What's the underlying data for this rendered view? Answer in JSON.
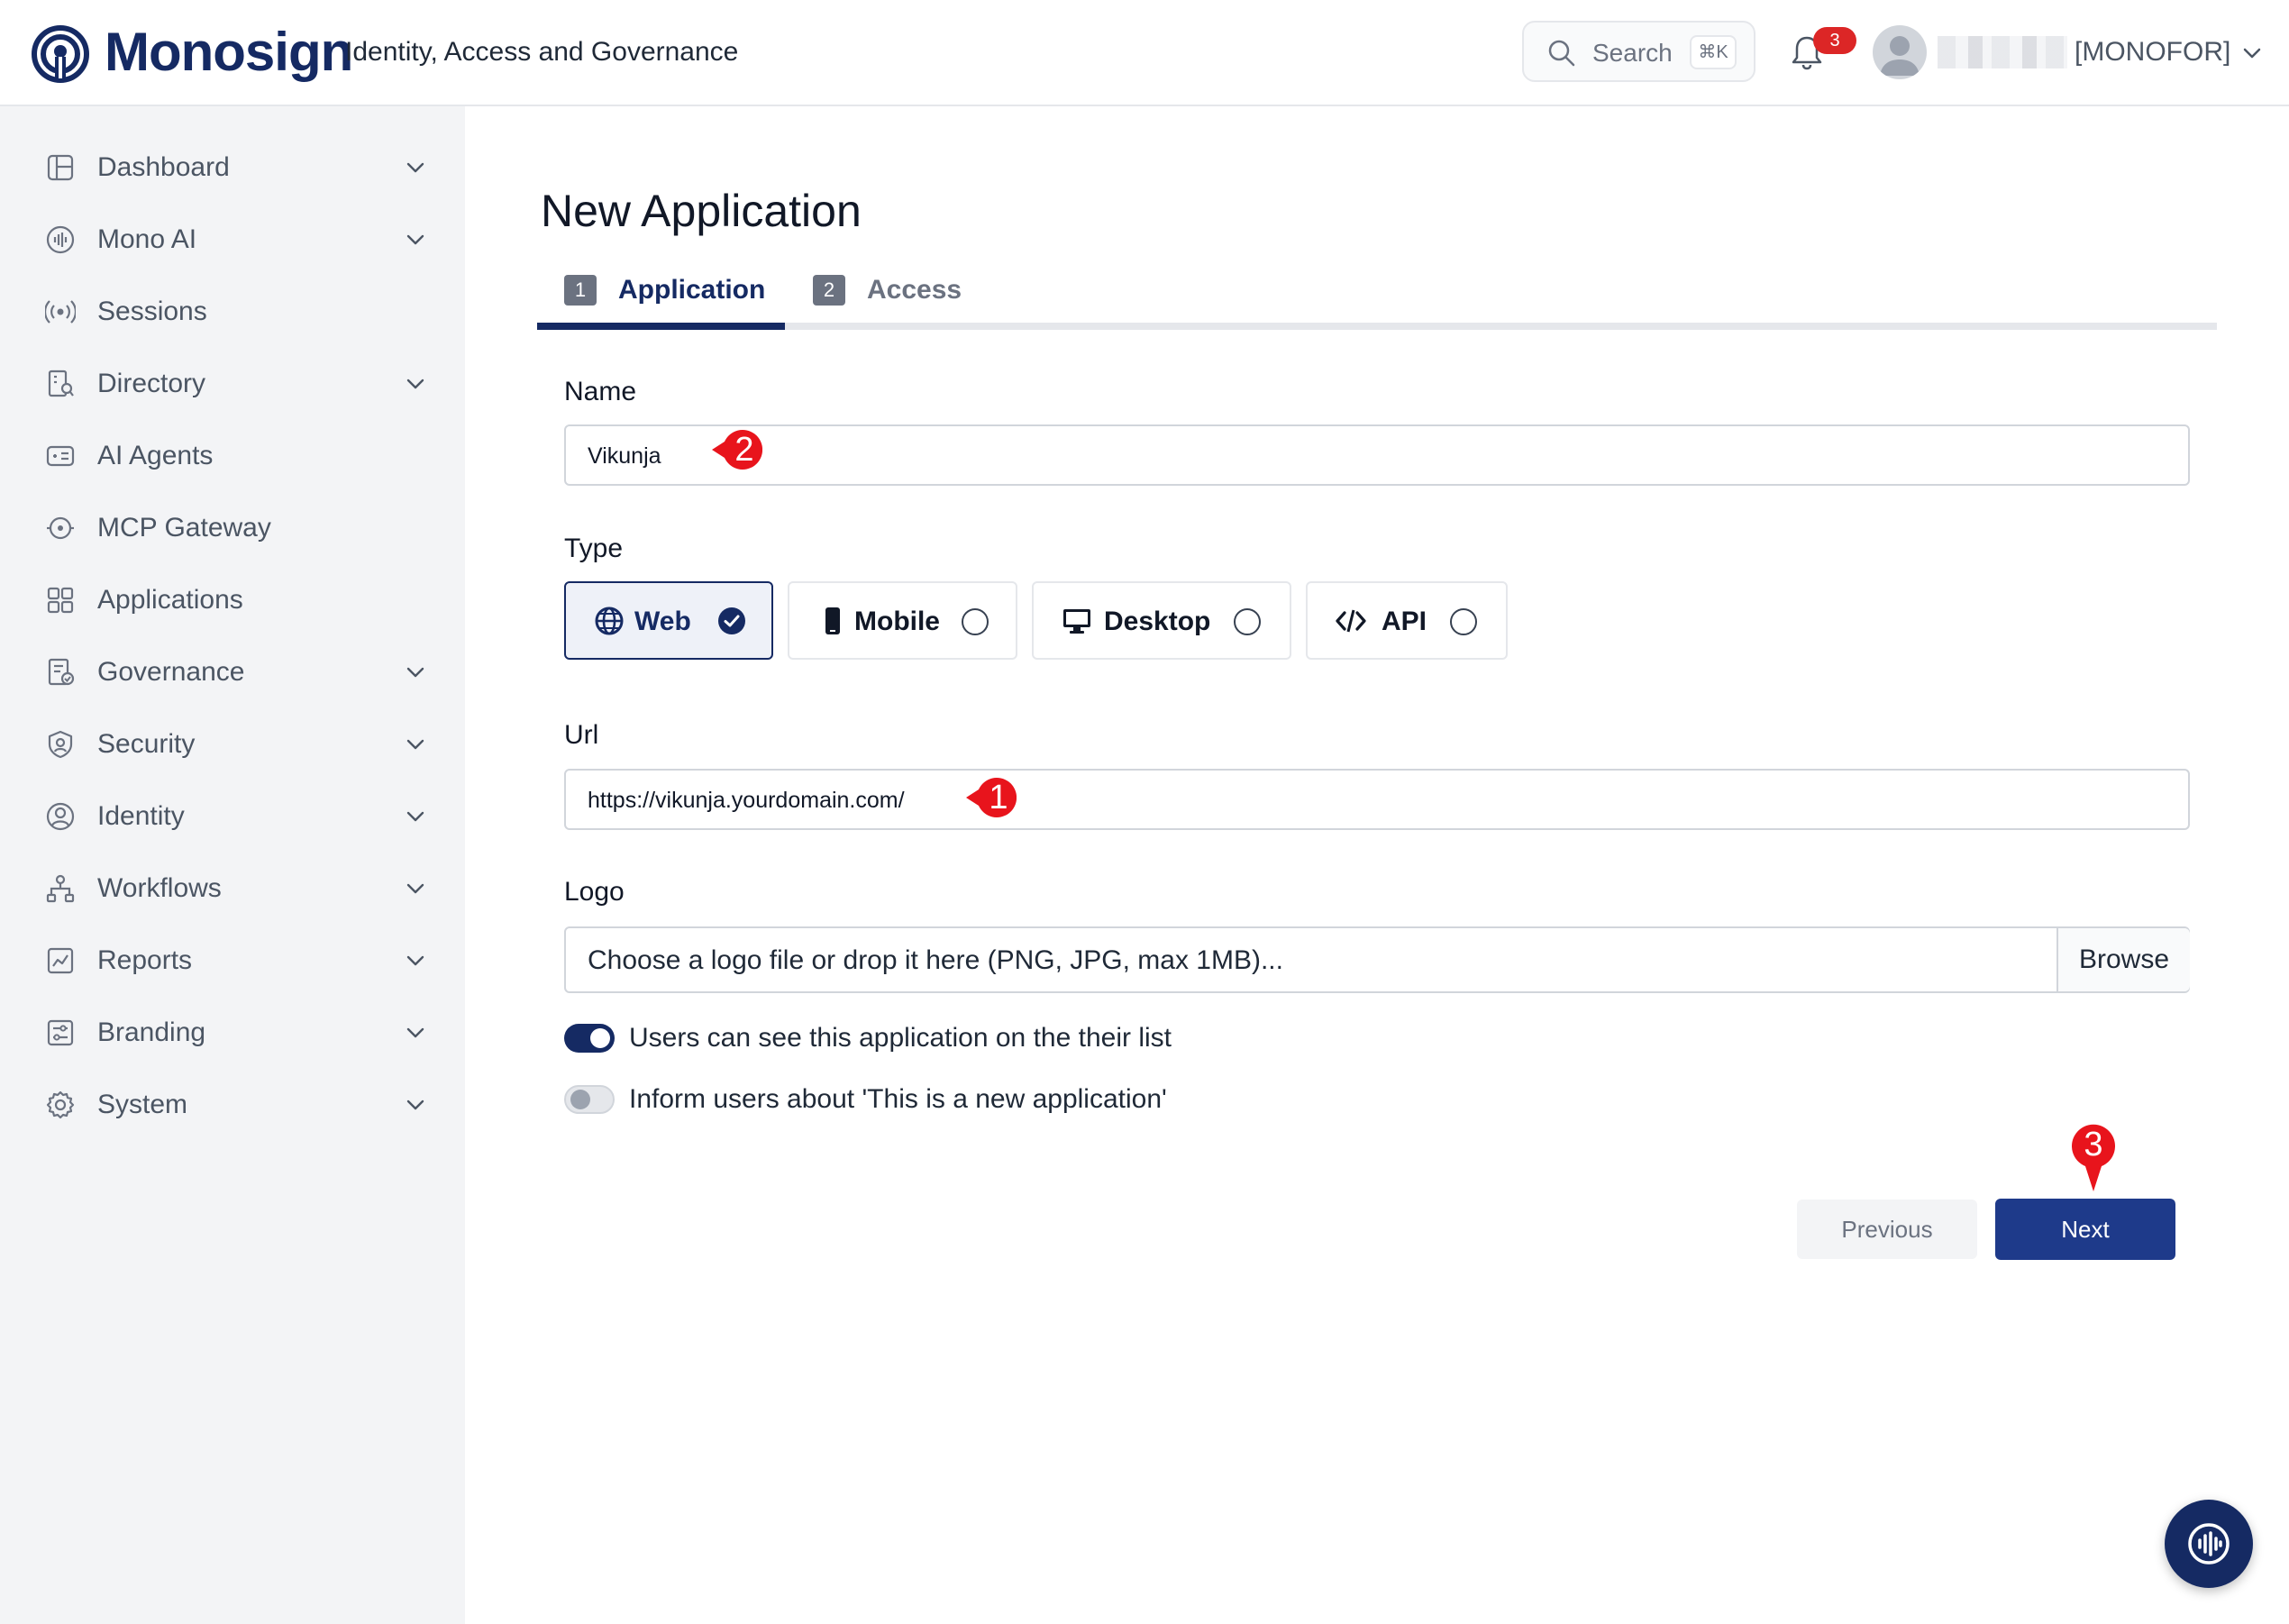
{
  "header": {
    "brand": "Monosign",
    "tagline": "Identity, Access and Governance",
    "search_label": "Search",
    "search_shortcut": "⌘K",
    "notification_count": "3",
    "org": "[MONOFOR]"
  },
  "sidebar": {
    "items": [
      {
        "label": "Dashboard",
        "icon": "dashboard-icon",
        "has_chevron": true
      },
      {
        "label": "Mono AI",
        "icon": "mono-ai-icon",
        "has_chevron": true
      },
      {
        "label": "Sessions",
        "icon": "sessions-icon",
        "has_chevron": false
      },
      {
        "label": "Directory",
        "icon": "directory-icon",
        "has_chevron": true
      },
      {
        "label": "AI Agents",
        "icon": "ai-agents-icon",
        "has_chevron": false
      },
      {
        "label": "MCP Gateway",
        "icon": "mcp-gateway-icon",
        "has_chevron": false
      },
      {
        "label": "Applications",
        "icon": "applications-icon",
        "has_chevron": false
      },
      {
        "label": "Governance",
        "icon": "governance-icon",
        "has_chevron": true
      },
      {
        "label": "Security",
        "icon": "security-icon",
        "has_chevron": true
      },
      {
        "label": "Identity",
        "icon": "identity-icon",
        "has_chevron": true
      },
      {
        "label": "Workflows",
        "icon": "workflows-icon",
        "has_chevron": true
      },
      {
        "label": "Reports",
        "icon": "reports-icon",
        "has_chevron": true
      },
      {
        "label": "Branding",
        "icon": "branding-icon",
        "has_chevron": true
      },
      {
        "label": "System",
        "icon": "system-icon",
        "has_chevron": true
      }
    ]
  },
  "main": {
    "title": "New Application",
    "tabs": [
      {
        "num": "1",
        "label": "Application",
        "active": true
      },
      {
        "num": "2",
        "label": "Access",
        "active": false
      }
    ],
    "form": {
      "name_label": "Name",
      "name_value": "Vikunja",
      "type_label": "Type",
      "types": [
        {
          "label": "Web",
          "icon": "globe-icon",
          "selected": true
        },
        {
          "label": "Mobile",
          "icon": "mobile-icon",
          "selected": false
        },
        {
          "label": "Desktop",
          "icon": "desktop-icon",
          "selected": false
        },
        {
          "label": "API",
          "icon": "code-icon",
          "selected": false
        }
      ],
      "url_label": "Url",
      "url_value": "https://vikunja.yourdomain.com/",
      "logo_label": "Logo",
      "logo_placeholder": "Choose a logo file or drop it here (PNG, JPG, max 1MB)...",
      "browse_label": "Browse",
      "toggle_visible_label": "Users can see this application on the their list",
      "toggle_visible_on": true,
      "toggle_inform_label": "Inform users about 'This is a new application'",
      "toggle_inform_on": false
    },
    "buttons": {
      "previous": "Previous",
      "next": "Next"
    }
  },
  "annotations": [
    "1",
    "2",
    "3"
  ],
  "colors": {
    "brand": "#152a63",
    "primary_button": "#1e3a8a",
    "marker": "#e8141c",
    "badge": "#dc2626"
  }
}
